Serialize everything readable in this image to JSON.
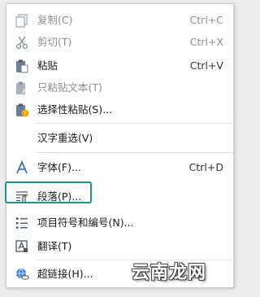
{
  "menu": {
    "items": [
      {
        "label": "复制(C)",
        "shortcut": "Ctrl+C",
        "icon": "copy-icon",
        "disabled": true
      },
      {
        "label": "剪切(T)",
        "shortcut": "Ctrl+X",
        "icon": "scissors-icon",
        "disabled": true
      },
      {
        "label": "粘贴",
        "shortcut": "Ctrl+V",
        "icon": "paste-icon",
        "disabled": false
      },
      {
        "label": "只粘贴文本(T)",
        "shortcut": "",
        "icon": "paste-text-icon",
        "disabled": true
      },
      {
        "label": "选择性粘贴(S)...",
        "shortcut": "",
        "icon": "paste-special-icon",
        "disabled": false
      },
      {
        "label": "汉字重选(V)",
        "shortcut": "",
        "icon": "",
        "disabled": false
      },
      {
        "label": "字体(F)...",
        "shortcut": "Ctrl+D",
        "icon": "font-icon",
        "disabled": false
      },
      {
        "label": "段落(P)...",
        "shortcut": "",
        "icon": "paragraph-icon",
        "disabled": false
      },
      {
        "label": "项目符号和编号(N)...",
        "shortcut": "",
        "icon": "list-icon",
        "disabled": false
      },
      {
        "label": "翻译(T)",
        "shortcut": "",
        "icon": "translate-icon",
        "disabled": false
      },
      {
        "label": "超链接(H)...",
        "shortcut": "",
        "icon": "hyperlink-icon",
        "disabled": false
      }
    ]
  },
  "highlight_color": "#1f8f8f",
  "watermark": "云南龙网"
}
